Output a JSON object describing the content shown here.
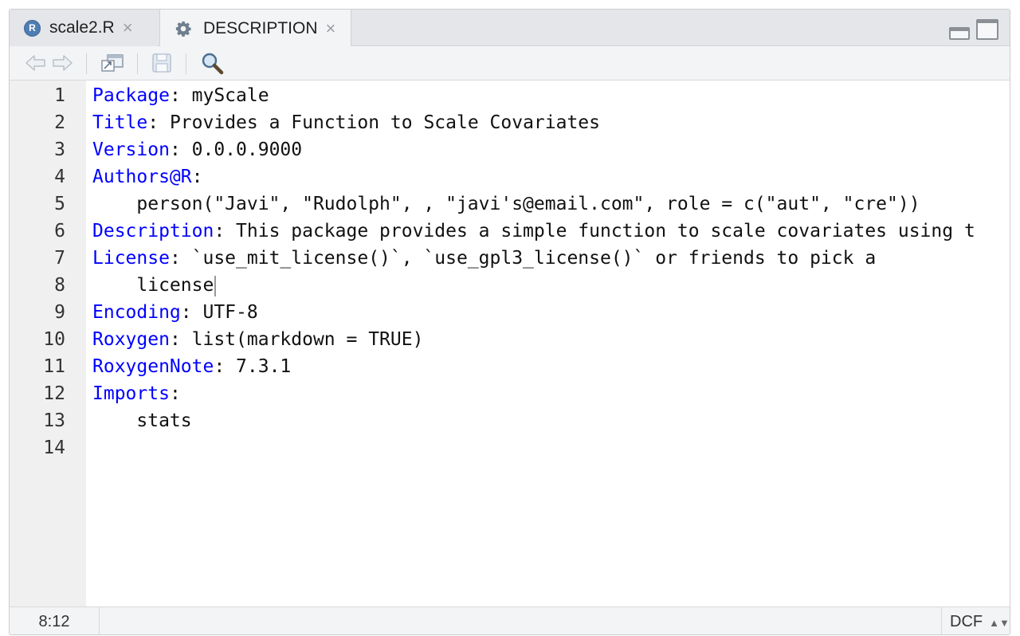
{
  "tabs": [
    {
      "label": "scale2.R",
      "icon": "r-file-icon",
      "active": false
    },
    {
      "label": "DESCRIPTION",
      "icon": "gear-icon",
      "active": true
    }
  ],
  "tab_close_glyph": "×",
  "toolbar": {
    "back": "arrow-left-icon",
    "forward": "arrow-right-icon",
    "show_in_window": "popout-icon",
    "save": "save-icon",
    "find": "search-icon"
  },
  "editor": {
    "line_numbers": [
      "1",
      "2",
      "3",
      "4",
      "5",
      "6",
      "7",
      "8",
      "9",
      "10",
      "11",
      "12",
      "13",
      "14"
    ],
    "lines": [
      {
        "key": "Package",
        "sep": ":",
        "rest": " myScale"
      },
      {
        "key": "Title",
        "sep": ":",
        "rest": " Provides a Function to Scale Covariates"
      },
      {
        "key": "Version",
        "sep": ":",
        "rest": " 0.0.0.9000"
      },
      {
        "key": "Authors@R",
        "sep": ":",
        "rest": ""
      },
      {
        "key": "",
        "sep": "",
        "rest": "    person(\"Javi\", \"Rudolph\", , \"javi's@email.com\", role = c(\"aut\", \"cre\"))"
      },
      {
        "key": "Description",
        "sep": ":",
        "rest": " This package provides a simple function to scale covariates using t"
      },
      {
        "key": "License",
        "sep": ":",
        "rest": " `use_mit_license()`, `use_gpl3_license()` or friends to pick a"
      },
      {
        "key": "",
        "sep": "",
        "rest": "    license"
      },
      {
        "key": "Encoding",
        "sep": ":",
        "rest": " UTF-8"
      },
      {
        "key": "Roxygen",
        "sep": ":",
        "rest": " list(markdown = TRUE)"
      },
      {
        "key": "RoxygenNote",
        "sep": ":",
        "rest": " 7.3.1"
      },
      {
        "key": "Imports",
        "sep": ":",
        "rest": ""
      },
      {
        "key": "",
        "sep": "",
        "rest": "    stats"
      },
      {
        "key": "",
        "sep": "",
        "rest": ""
      }
    ],
    "key_color": "#0000ff"
  },
  "status": {
    "cursor_position": "8:12",
    "file_type": "DCF",
    "file_type_arrows": "▲▼"
  }
}
